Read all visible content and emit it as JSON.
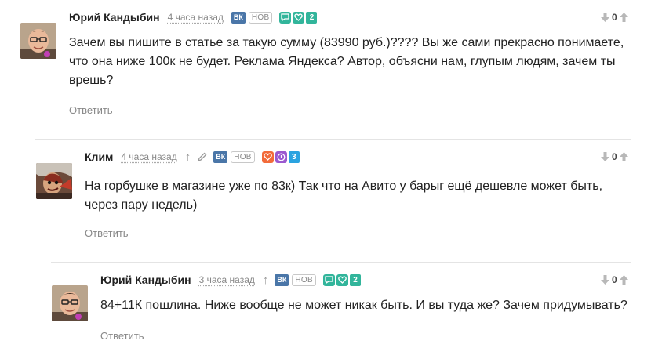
{
  "comments": [
    {
      "author": "Юрий Кандыбин",
      "time": "4 часа назад",
      "vk": "ВК",
      "badge_new": "НОВ",
      "badge_count": "2",
      "text": "Зачем вы пишите в статье за такую сумму (83990 руб.)???? Вы же сами прекрасно понимаете, что она ниже 100к не будет. Реклама Яндекса? Автор, объясни нам, глупым людям, зачем ты врешь?",
      "reply": "Ответить",
      "score": "0"
    },
    {
      "author": "Клим",
      "time": "4 часа назад",
      "reply_arrow": "↑",
      "vk": "ВК",
      "badge_new": "НОВ",
      "badge_count": "3",
      "text": "На горбушке в магазине уже по 83к) Так что на Авито у барыг ещё дешевле может быть, через пару недель)",
      "reply": "Ответить",
      "score": "0"
    },
    {
      "author": "Юрий Кандыбин",
      "time": "3 часа назад",
      "reply_arrow": "↑",
      "vk": "ВК",
      "badge_new": "НОВ",
      "badge_count": "2",
      "text": "84+11К пошлина. Ниже вообще не может никак быть. И вы туда же? Зачем придумывать?",
      "reply": "Ответить",
      "score": "0"
    }
  ],
  "colors": {
    "teal": "#32b59b",
    "orange": "#f26b3a",
    "purple": "#9b59d0",
    "blue": "#2aa3e0",
    "vk": "#4a76a8"
  },
  "icons": [
    "avatar-yuri",
    "avatar-klim",
    "vk-icon",
    "comment-icon",
    "heart-icon",
    "clock-icon",
    "pencil-icon",
    "arrow-down-icon",
    "arrow-up-icon"
  ]
}
